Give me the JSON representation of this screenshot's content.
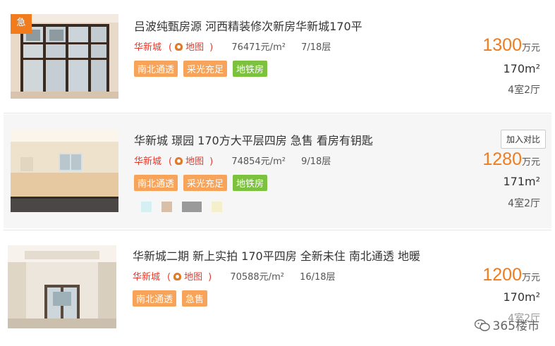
{
  "listings": [
    {
      "title": "吕波纯甄房源 河西精装修次新房华新城170平",
      "area": "华新城",
      "paren_open": "(",
      "map_label": "地图",
      "paren_close": ")",
      "unit_price": "76471元/m²",
      "floor": "7/18层",
      "tags": [
        "南北通透",
        "采光充足",
        "地铁房"
      ],
      "price": "1300",
      "price_unit": "万元",
      "size": "170m²",
      "rooms": "4室2厅",
      "badge": "急"
    },
    {
      "title": "华新城 璟园 170方大平层四房 急售 看房有钥匙",
      "area": "华新城",
      "paren_open": "(",
      "map_label": "地图",
      "paren_close": ")",
      "unit_price": "74854元/m²",
      "floor": "9/18层",
      "tags": [
        "南北通透",
        "采光充足",
        "地铁房"
      ],
      "price": "1280",
      "price_unit": "万元",
      "size": "171m²",
      "rooms": "4室2厅",
      "compare_label": "加入对比"
    },
    {
      "title": "华新城二期 新上实拍 170平四房 全新未住 南北通透 地暖",
      "area": "华新城",
      "paren_open": "(",
      "map_label": "地图",
      "paren_close": ")",
      "unit_price": "70588元/m²",
      "floor": "16/18层",
      "tags": [
        "南北通透",
        "急售"
      ],
      "price": "1200",
      "price_unit": "万元",
      "size": "170m²",
      "rooms": "4室2厅"
    }
  ],
  "watermark": "365楼市"
}
